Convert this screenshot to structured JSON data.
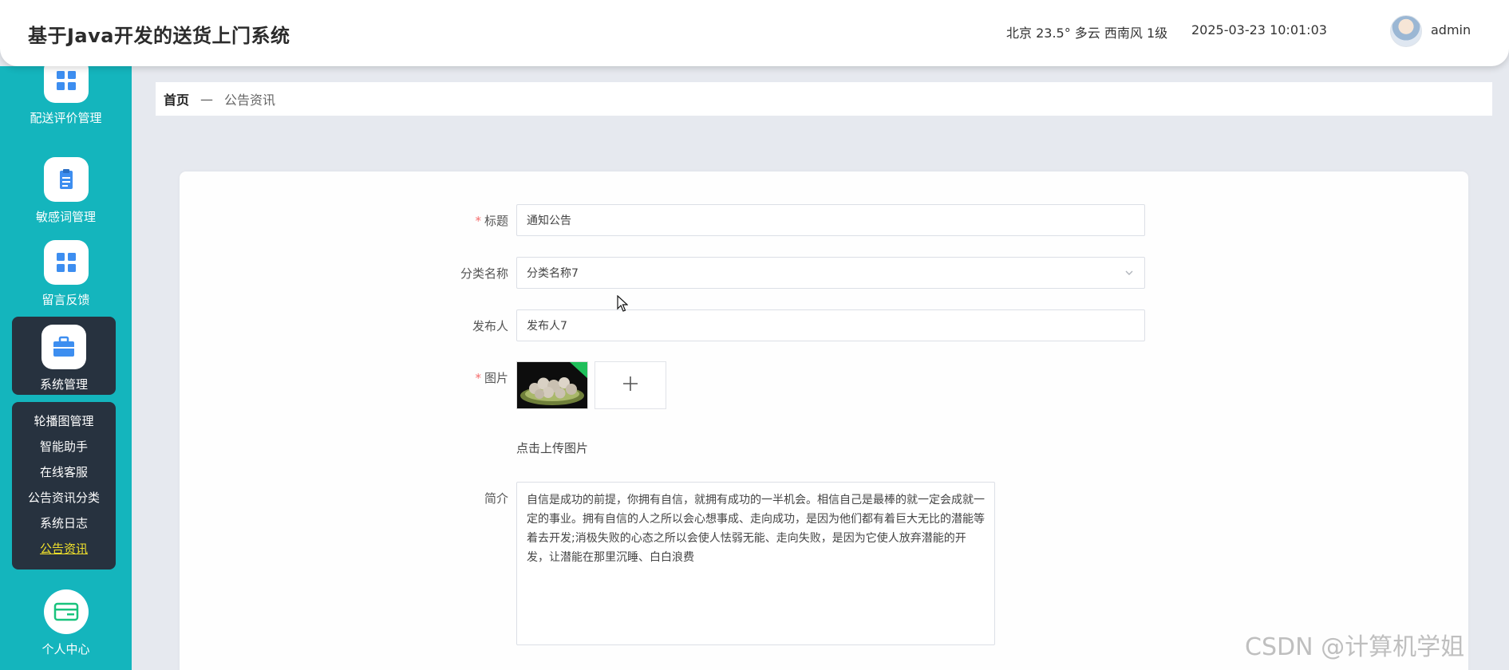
{
  "app": {
    "title": "基于Java开发的送货上门系统",
    "weather": "北京  23.5°  多云  西南风  1级",
    "datetime": "2025-03-23 10:01:03",
    "username": "admin"
  },
  "sidebar": {
    "items": [
      {
        "label": "配送评价管理",
        "icon": "grid-icon"
      },
      {
        "label": "敏感词管理",
        "icon": "clipboard-icon"
      },
      {
        "label": "留言反馈",
        "icon": "grid-icon"
      },
      {
        "label": "系统管理",
        "icon": "briefcase-icon"
      },
      {
        "label": "个人中心",
        "icon": "wallet-icon"
      }
    ],
    "submenu": [
      "轮播图管理",
      "智能助手",
      "在线客服",
      "公告资讯分类",
      "系统日志",
      "公告资讯"
    ]
  },
  "breadcrumb": {
    "home": "首页",
    "separator": "—",
    "current": "公告资讯"
  },
  "form": {
    "title_label": "标题",
    "title_value": "通知公告",
    "category_label": "分类名称",
    "category_value": "分类名称7",
    "publisher_label": "发布人",
    "publisher_value": "发布人7",
    "image_label": "图片",
    "upload_tip": "点击上传图片",
    "intro_label": "简介",
    "intro_value": "自信是成功的前提，你拥有自信，就拥有成功的一半机会。相信自己是最棒的就一定会成就一定的事业。拥有自信的人之所以会心想事成、走向成功，是因为他们都有着巨大无比的潜能等着去开发;消极失败的心态之所以会使人怯弱无能、走向失败，是因为它使人放弃潜能的开发，让潜能在那里沉睡、白白浪费",
    "required_mark": "*"
  },
  "watermark": "CSDN @计算机学姐",
  "colors": {
    "sidebar_bg": "#14b5bd",
    "submenu_bg": "#27323f",
    "active_link": "#f2e12b",
    "required": "#f56c6c",
    "icon_blue": "#3d8ef0"
  }
}
